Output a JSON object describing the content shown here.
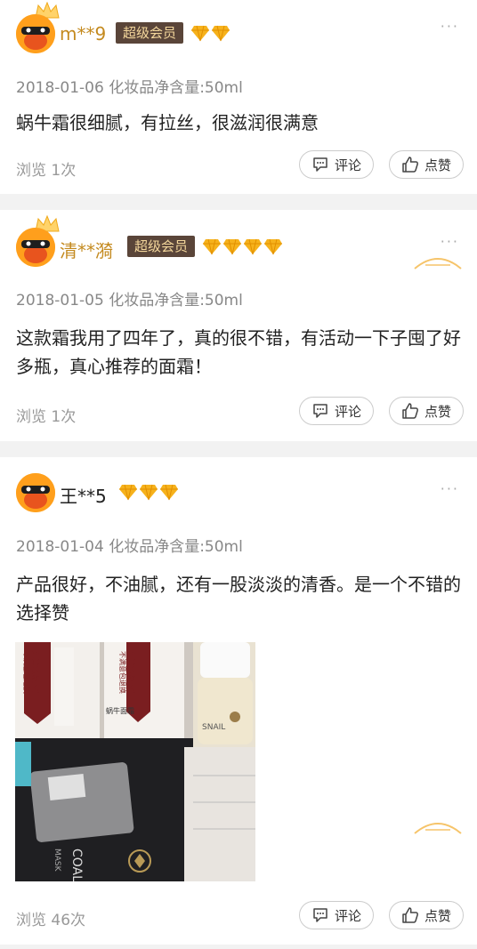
{
  "reviews": [
    {
      "username": "m**9",
      "badge": "超级会员",
      "diamond_count": 2,
      "meta": "2018-01-06 化妆品净含量:50ml",
      "content": "蜗牛霜很细腻，有拉丝，很滋润很满意",
      "views": "浏览 1次",
      "comment_label": "评论",
      "like_label": "点赞"
    },
    {
      "username": "清**漪",
      "badge": "超级会员",
      "diamond_count": 4,
      "meta": "2018-01-05 化妆品净含量:50ml",
      "content": "这款霜我用了四年了，真的很不错，有活动一下子囤了好多瓶，真心推荐的面霜！",
      "views": "浏览 1次",
      "comment_label": "评论",
      "like_label": "点赞"
    },
    {
      "username": "王**5",
      "diamond_count": 3,
      "meta": "2018-01-04 化妆品净含量:50ml",
      "content": "产品很好，不油腻，还有一股淡淡的清香。是一个不错的选择赞",
      "views": "浏览 46次",
      "comment_label": "评论",
      "like_label": "点赞",
      "photo_text": {
        "box1_a": "不满意包退换",
        "box1_b": "先试同款小样",
        "box2_a": "不满意包退换",
        "box2_b": "先试同款小样",
        "product": "蜗牛面霜",
        "jar_label": "SNAIL",
        "bag_text": "COAL",
        "bag_text2": "MASK"
      }
    }
  ],
  "more_label": "···",
  "colors": {
    "username_gold": "#c48a1f",
    "badge_bg": "#5a4539",
    "badge_text": "#f4d79c",
    "diamond": "#f6b21c",
    "divider": "#f2f2f2"
  }
}
